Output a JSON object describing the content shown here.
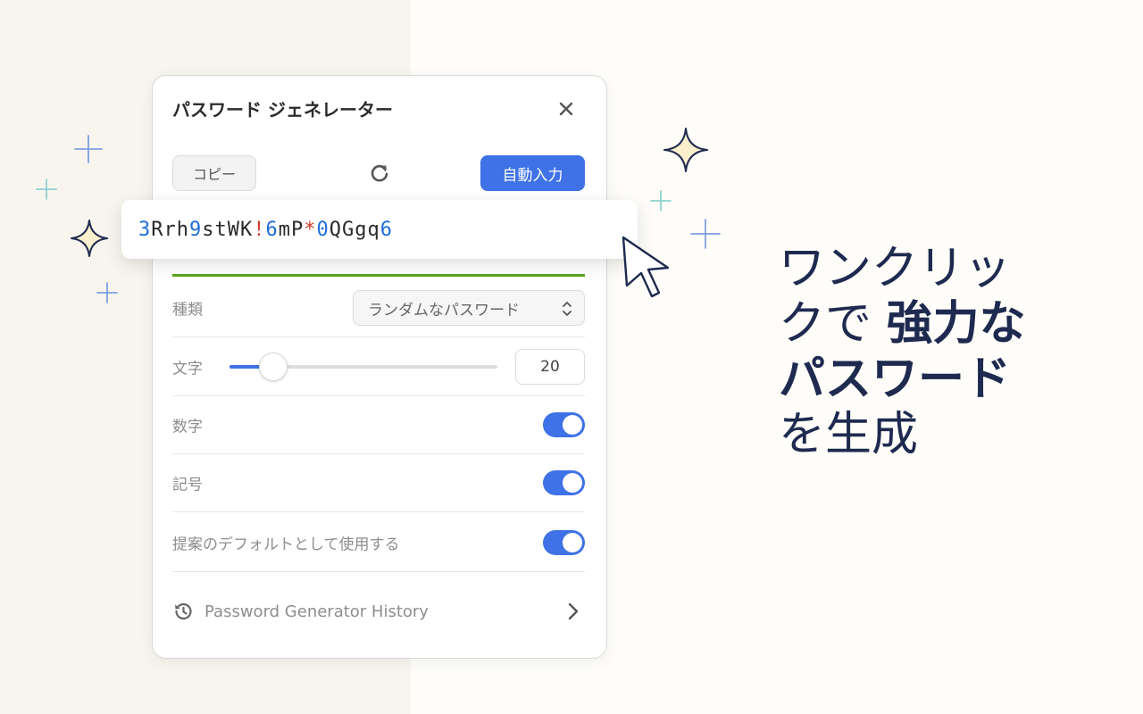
{
  "panel": {
    "title": "パスワード ジェネレーター",
    "copy_label": "コピー",
    "autofill_label": "自動入力",
    "password": [
      {
        "t": "3",
        "k": "d"
      },
      {
        "t": "Rrh",
        "k": "n"
      },
      {
        "t": "9",
        "k": "d"
      },
      {
        "t": "stWK",
        "k": "n"
      },
      {
        "t": "!",
        "k": "s"
      },
      {
        "t": "6",
        "k": "d"
      },
      {
        "t": "mP",
        "k": "n"
      },
      {
        "t": "*",
        "k": "s"
      },
      {
        "t": "0",
        "k": "d"
      },
      {
        "t": "QGgq",
        "k": "n"
      },
      {
        "t": "6",
        "k": "d"
      }
    ],
    "type_label": "種類",
    "type_value": "ランダムなパスワード",
    "length_label": "文字",
    "length_value": "20",
    "length_fraction": 0.16,
    "digits_label": "数字",
    "digits_on": true,
    "symbols_label": "記号",
    "symbols_on": true,
    "default_label": "提案のデフォルトとして使用する",
    "default_on": true,
    "history_label": "Password Generator History"
  },
  "headline": {
    "line1": "ワンクリッ",
    "line2_normal": "クで ",
    "line2_bold": "強力な",
    "line3_bold": "パスワード",
    "line4": "を生成"
  },
  "colors": {
    "accent": "#3f72e6",
    "digit": "#1f6ed4",
    "symbol": "#d33a2f",
    "strength": "#5aa61e",
    "headline": "#1e2a4f"
  },
  "icons": [
    "close-icon",
    "refresh-icon",
    "chevron-updown-icon",
    "history-icon",
    "chevron-right-icon",
    "cursor-icon",
    "sparkle-icon",
    "plus-sparkle-icon"
  ]
}
